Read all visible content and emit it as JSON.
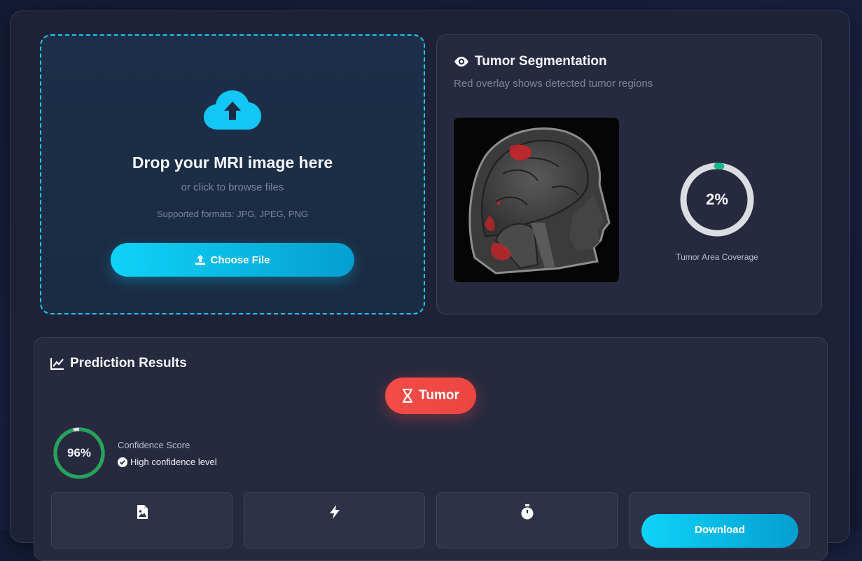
{
  "upload": {
    "title": "Drop your MRI image here",
    "subtitle": "or click to browse files",
    "formats": "Supported formats: JPG, JPEG, PNG",
    "choose_label": "Choose File"
  },
  "segmentation": {
    "title": "Tumor Segmentation",
    "subtitle": "Red overlay shows detected tumor regions",
    "coverage_value": "2%",
    "coverage_fraction": 0.02,
    "coverage_label": "Tumor Area Coverage"
  },
  "prediction": {
    "title": "Prediction Results",
    "result_label": "Tumor",
    "confidence_value": "96%",
    "confidence_fraction": 0.96,
    "confidence_label": "Confidence Score",
    "confidence_level": "High confidence level",
    "download_label": "Download"
  },
  "colors": {
    "accent": "#1cc7f0",
    "tumor": "#f44c47",
    "confidence": "#22a55a",
    "coverage": "#16b889"
  },
  "icons": [
    "cloud-upload-icon",
    "upload-icon",
    "eye-icon",
    "chart-line-icon",
    "dna-icon",
    "check-circle-icon",
    "file-image-icon",
    "bolt-icon",
    "stopwatch-icon"
  ]
}
